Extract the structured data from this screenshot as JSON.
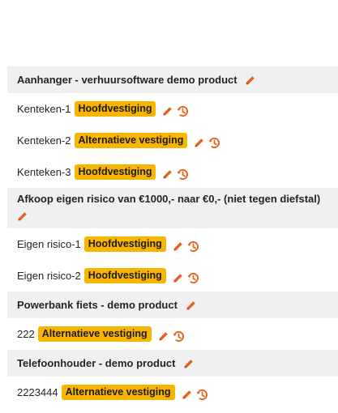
{
  "colors": {
    "accent": "#e8601c",
    "badge": "#f7b500",
    "header_bg": "#f0f0f0"
  },
  "icons": {
    "edit": "pencil-icon",
    "history": "clock-history-icon"
  },
  "groups": [
    {
      "title": "Aanhanger - verhuursoftware demo product",
      "items": [
        {
          "name": "Kenteken-1",
          "location": "Hoofdvestiging"
        },
        {
          "name": "Kenteken-2",
          "location": "Alternatieve vestiging"
        },
        {
          "name": "Kenteken-3",
          "location": "Hoofdvestiging"
        }
      ]
    },
    {
      "title": "Afkoop eigen risico van €1000,- naar €0,- (niet tegen diefstal)",
      "items": [
        {
          "name": "Eigen risico-1",
          "location": "Hoofdvestiging"
        },
        {
          "name": "Eigen risico-2",
          "location": "Hoofdvestiging"
        }
      ]
    },
    {
      "title": "Powerbank fiets - demo product",
      "items": [
        {
          "name": "222",
          "location": "Alternatieve vestiging"
        }
      ]
    },
    {
      "title": "Telefoonhouder - demo product",
      "items": [
        {
          "name": "2223444",
          "location": "Alternatieve vestiging"
        }
      ]
    }
  ]
}
